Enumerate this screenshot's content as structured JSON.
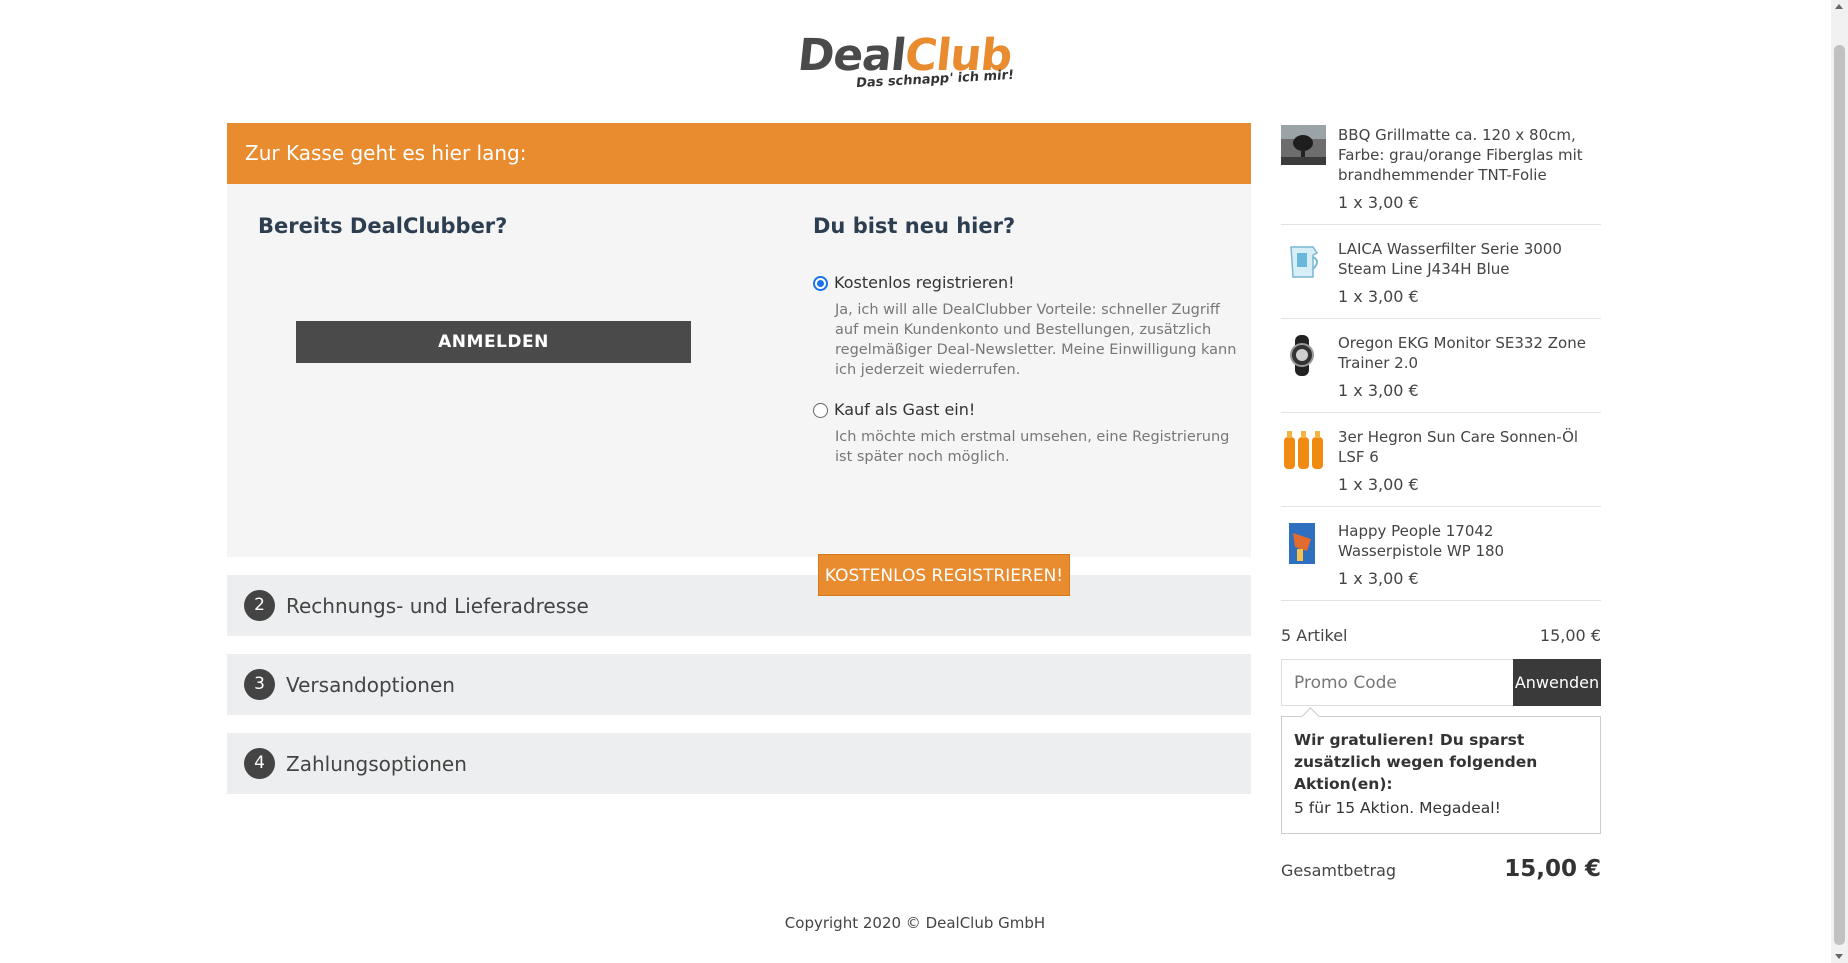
{
  "logo": {
    "deal": "Deal",
    "club": "Club",
    "tagline": "Das schnapp' ich mir!"
  },
  "banner": {
    "title": "Zur Kasse geht es hier lang:"
  },
  "login": {
    "existing_title": "Bereits DealClubber?",
    "login_button": "ANMELDEN",
    "new_title": "Du bist neu hier?",
    "option_register": {
      "label": "Kostenlos registrieren!",
      "description": "Ja, ich will alle DealClubber Vorteile: schneller Zugriff auf mein Kundenkonto und Bestellungen, zusätzlich regelmäßiger Deal-Newsletter. Meine Einwilligung kann ich jederzeit wiederrufen.",
      "checked": true
    },
    "option_guest": {
      "label": "Kauf als Gast ein!",
      "description": "Ich möchte mich erstmal umsehen, eine Registrierung ist später noch möglich.",
      "checked": false
    },
    "register_button": "KOSTENLOS REGISTRIEREN!"
  },
  "steps": [
    {
      "number": "2",
      "label": "Rechnungs- und Lieferadresse"
    },
    {
      "number": "3",
      "label": "Versandoptionen"
    },
    {
      "number": "4",
      "label": "Zahlungsoptionen"
    }
  ],
  "cart": {
    "items": [
      {
        "name": "BBQ Grillmatte ca. 120 x 80cm, Farbe: grau/orange Fiberglas mit brandhemmender TNT-Folie",
        "qty": "1 x 3,00 €",
        "icon": "grill-mat-thumbnail"
      },
      {
        "name": "LAICA Wasserfilter Serie 3000 Steam Line J434H Blue",
        "qty": "1 x 3,00 €",
        "icon": "water-filter-thumbnail"
      },
      {
        "name": "Oregon EKG Monitor SE332 Zone Trainer 2.0",
        "qty": "1 x 3,00 €",
        "icon": "heart-monitor-thumbnail"
      },
      {
        "name": "3er Hegron Sun Care Sonnen-Öl LSF 6",
        "qty": "1 x 3,00 €",
        "icon": "sun-oil-thumbnail"
      },
      {
        "name": "Happy People 17042 Wasserpistole WP 180",
        "qty": "1 x 3,00 €",
        "icon": "water-pistol-thumbnail"
      }
    ],
    "count_label": "5 Artikel",
    "subtotal": "15,00 €",
    "promo_placeholder": "Promo Code",
    "promo_button": "Anwenden",
    "notice_title": "Wir gratulieren! Du sparst zusätzlich wegen folgenden Aktion(en):",
    "notice_text": "5 für 15 Aktion. Megadeal!",
    "total_label": "Gesamtbetrag",
    "total_value": "15,00 €"
  },
  "footer": {
    "copyright": "Copyright 2020 © DealClub GmbH"
  },
  "colors": {
    "accent": "#e98c2f",
    "dark": "#4a4a4a",
    "radio": "#1a73e8"
  }
}
